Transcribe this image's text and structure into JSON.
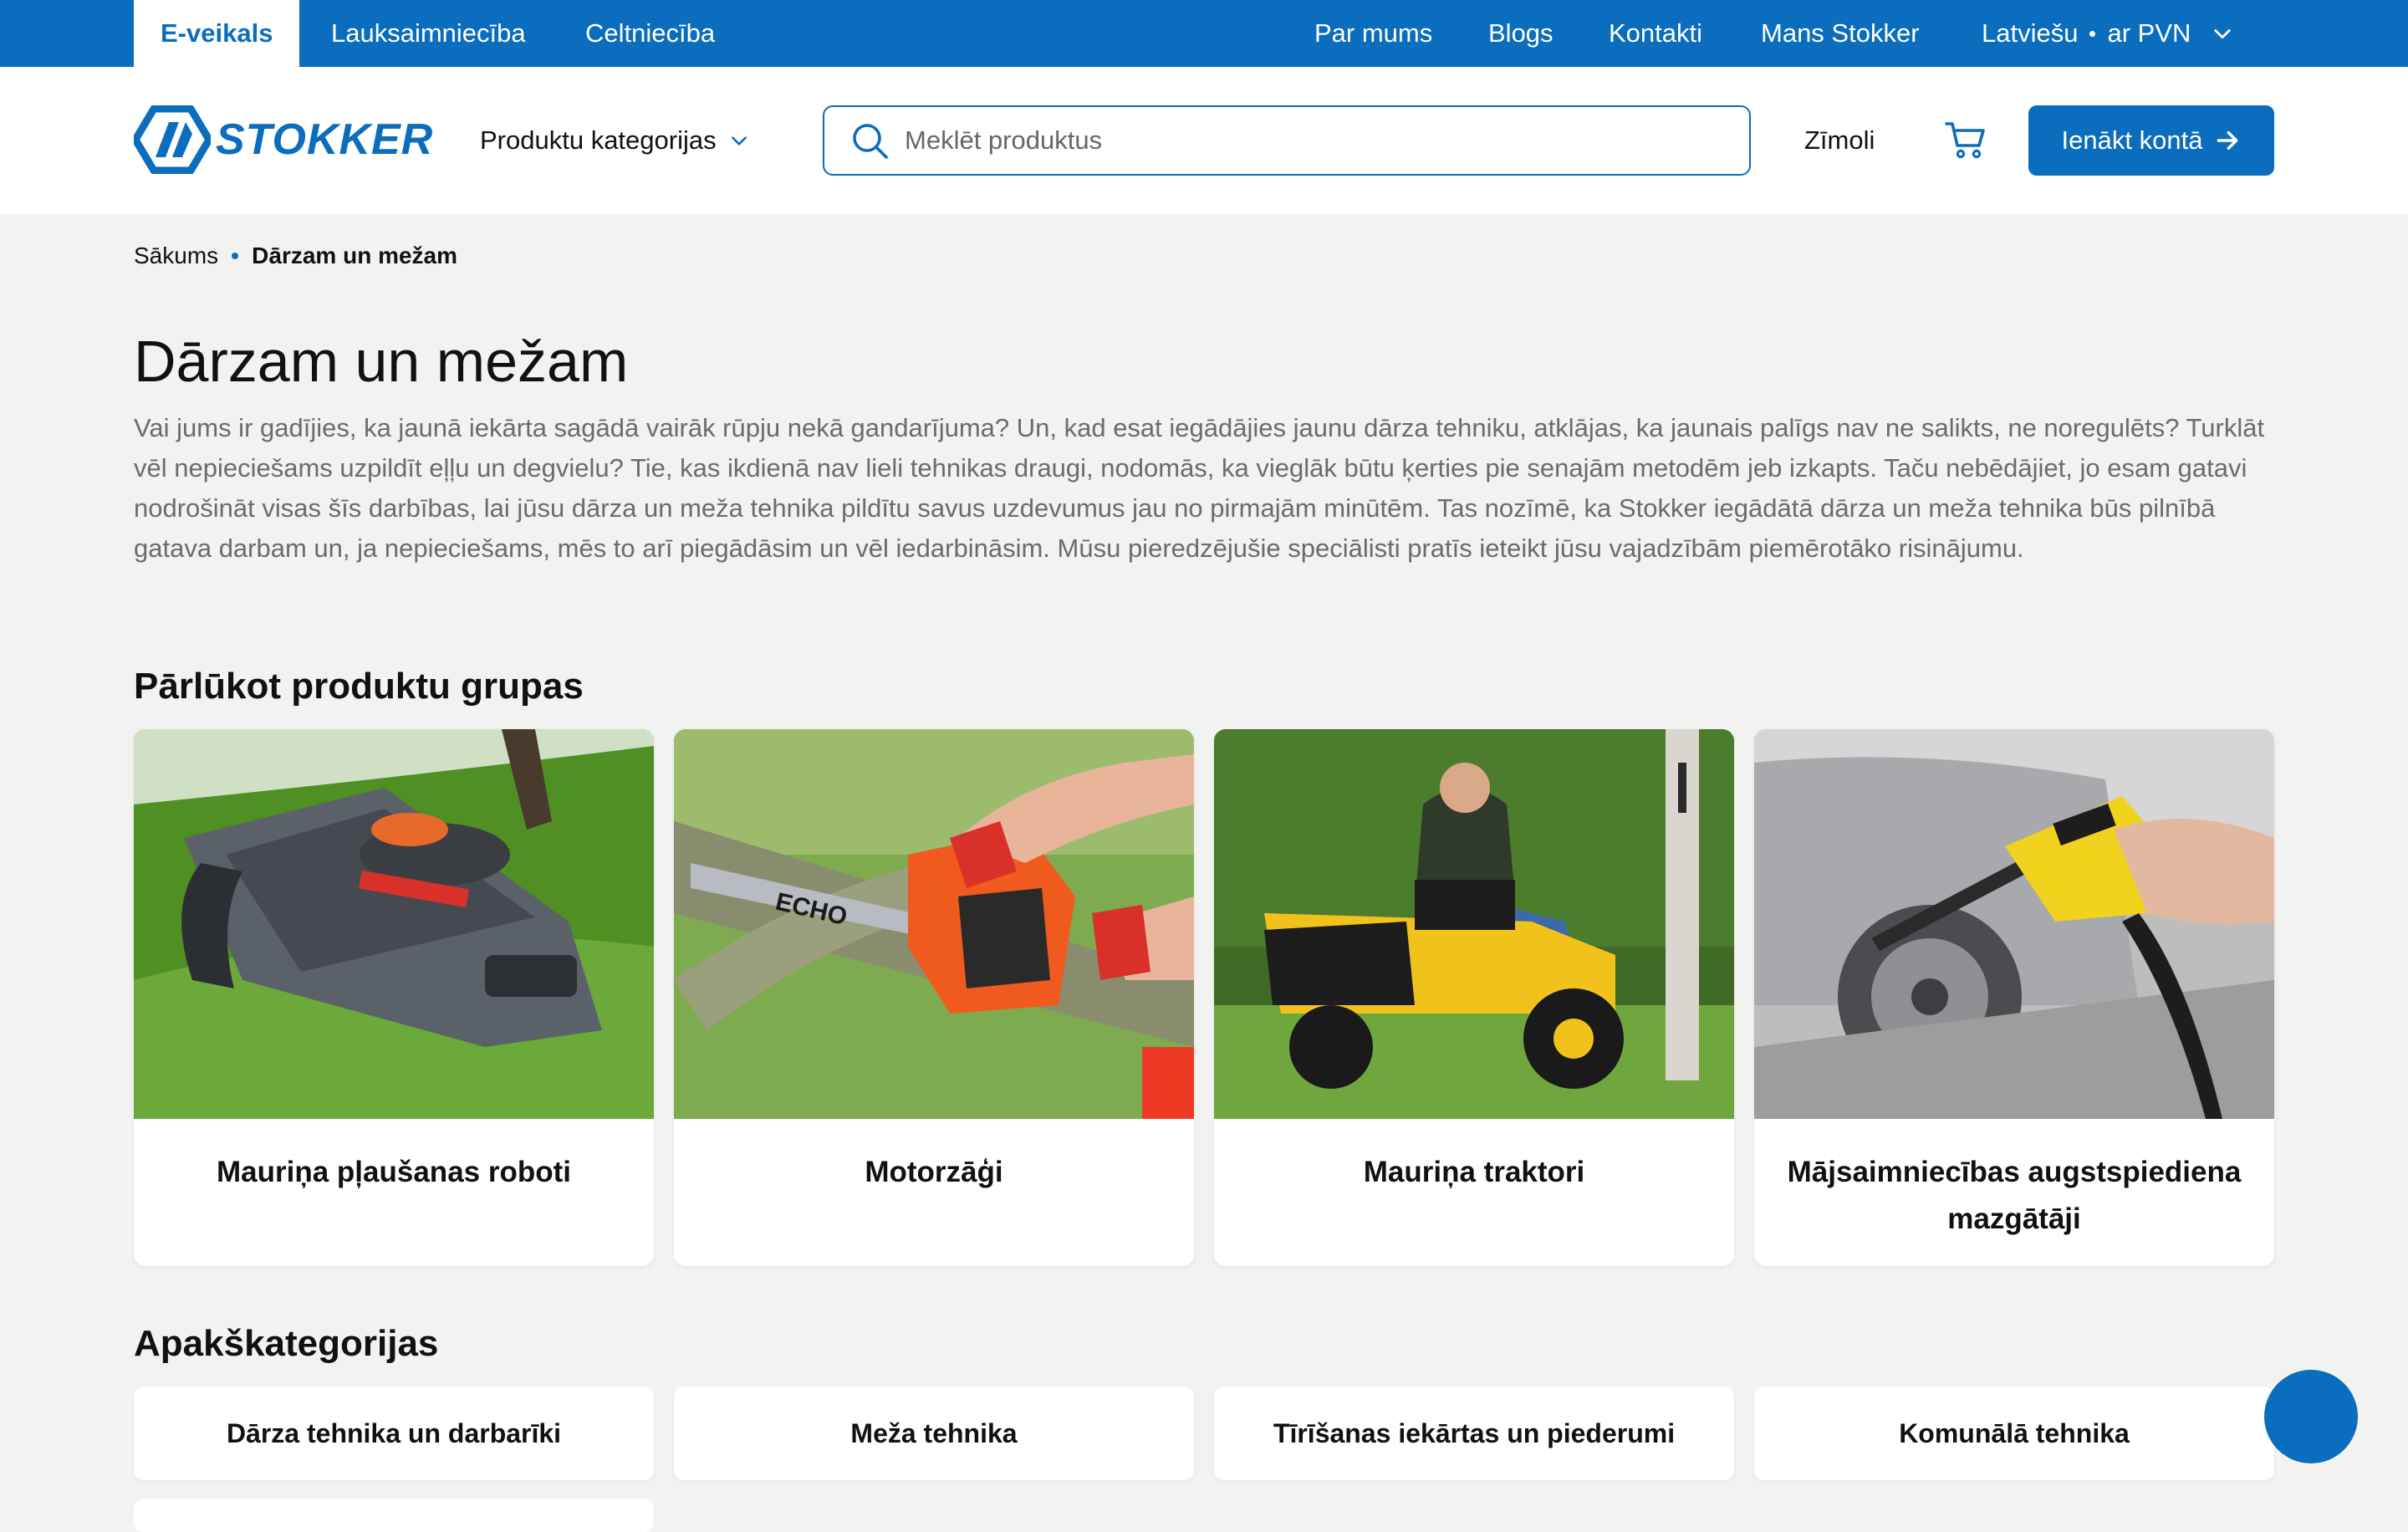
{
  "topbar": {
    "tabs": [
      {
        "label": "E-veikals",
        "active": true
      },
      {
        "label": "Lauksaimniecība",
        "active": false
      },
      {
        "label": "Celtniecība",
        "active": false
      }
    ],
    "links": [
      "Par mums",
      "Blogs",
      "Kontakti",
      "Mans Stokker"
    ],
    "language": "Latviešu",
    "vat": "ar PVN",
    "accent_color": "#0a6dbd"
  },
  "header": {
    "logo_text": "STOKKER",
    "categories_label": "Produktu kategorijas",
    "search_placeholder": "Meklēt produktus",
    "brands_label": "Zīmoli",
    "login_label": "Ienākt kontā"
  },
  "breadcrumb": {
    "home": "Sākums",
    "current": "Dārzam un mežam"
  },
  "page": {
    "title": "Dārzam un mežam",
    "intro": "Vai jums ir gadījies, ka jaunā iekārta sagādā vairāk rūpju nekā gandarījuma? Un, kad esat iegādājies jaunu dārza tehniku, atklājas, ka jaunais palīgs nav ne salikts, ne noregulēts? Turklāt vēl nepieciešams uzpildīt eļļu un degvielu? Tie, kas ikdienā nav lieli tehnikas draugi, nodomās, ka vieglāk būtu ķerties pie senajām metodēm jeb izkapts. Taču nebēdājiet, jo esam gatavi nodrošināt visas šīs darbības, lai jūsu dārza un meža tehnika pildītu savus uzdevumus jau no pirmajām minūtēm. Tas nozīmē, ka Stokker iegādātā dārza un meža tehnika būs pilnībā gatava darbam un, ja nepieciešams, mēs to arī piegādāsim un vēl iedarbināsim. Mūsu pieredzējušie speciālisti pratīs ieteikt jūsu vajadzībām piemērotāko risinājumu."
  },
  "groups": {
    "title": "Pārlūkot produktu grupas",
    "items": [
      {
        "label": "Mauriņa pļaušanas roboti",
        "image": "robot-mower-photo"
      },
      {
        "label": "Motorzāģi",
        "image": "chainsaw-photo"
      },
      {
        "label": "Mauriņa traktori",
        "image": "lawn-tractor-photo"
      },
      {
        "label": "Mājsaimniecības augstspiediena mazgātāji",
        "image": "pressure-washer-photo"
      }
    ]
  },
  "subcategories": {
    "title": "Apakškategorijas",
    "items": [
      "Dārza tehnika un darbarīki",
      "Meža tehnika",
      "Tīrīšanas iekārtas un piederumi",
      "Komunālā tehnika"
    ]
  }
}
